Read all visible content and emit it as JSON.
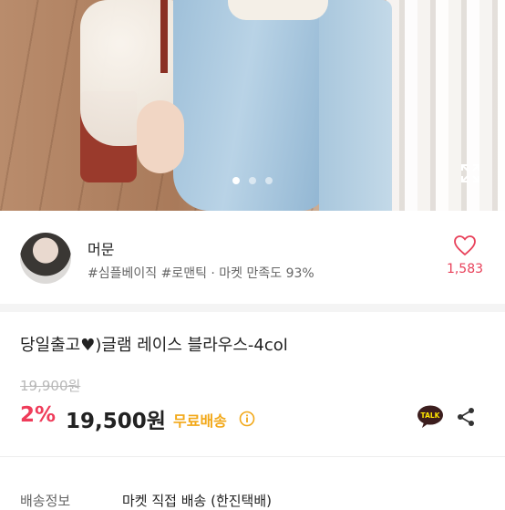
{
  "gallery": {
    "dots": 3,
    "active_dot": 0
  },
  "seller": {
    "name": "머문",
    "tags": "#심플베이직 #로맨틱 · 마켓 만족도 93%",
    "likes": "1,583"
  },
  "product": {
    "title": "당일출고♥)글램 레이스 블라우스-4col",
    "original_price": "19,900원",
    "discount": "2%",
    "price": "19,500원",
    "shipping_badge": "무료배송"
  },
  "actions": {
    "talk_label": "TALK"
  },
  "shipping": {
    "label": "배송정보",
    "value": "마켓 직접 배송 (한진택배)"
  },
  "colors": {
    "accent": "#ef3c5a",
    "free_ship": "#f2a818",
    "talk_bg": "#3c1e1e",
    "talk_yellow": "#fee500"
  }
}
